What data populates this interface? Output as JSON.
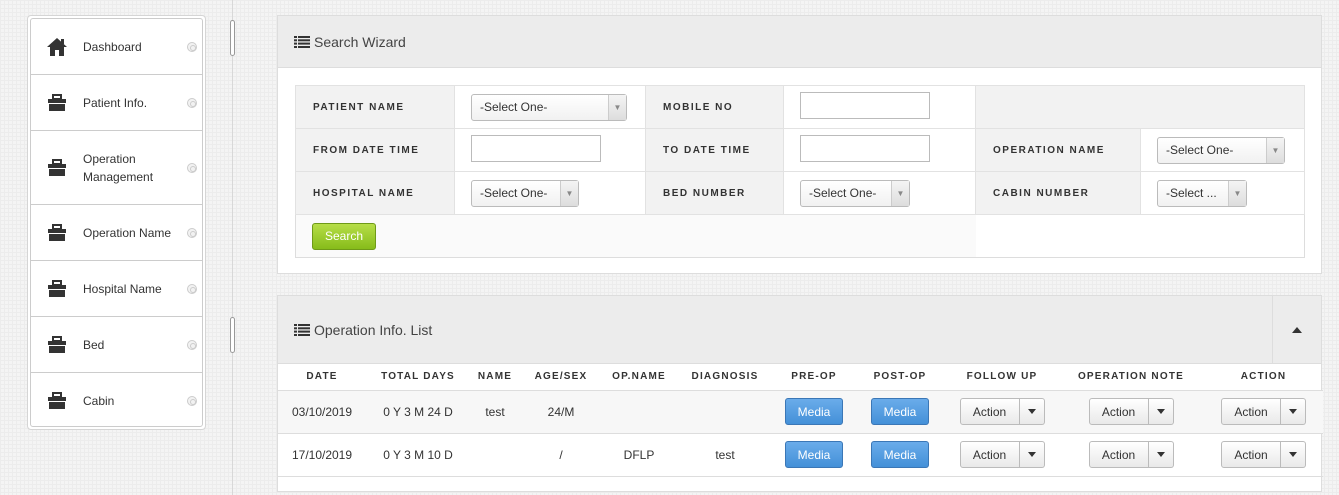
{
  "sidebar": {
    "items": [
      {
        "label": "Dashboard",
        "icon": "home-icon"
      },
      {
        "label": "Patient Info.",
        "icon": "briefcase-icon"
      },
      {
        "label": "Operation Management",
        "icon": "briefcase-icon"
      },
      {
        "label": "Operation Name",
        "icon": "briefcase-icon"
      },
      {
        "label": "Hospital Name",
        "icon": "briefcase-icon"
      },
      {
        "label": "Bed",
        "icon": "briefcase-icon"
      },
      {
        "label": "Cabin",
        "icon": "briefcase-icon"
      }
    ]
  },
  "search": {
    "title": "Search Wizard",
    "labels": {
      "patient_name": "PATIENT NAME",
      "mobile_no": "MOBILE NO",
      "from_date": "FROM DATE TIME",
      "to_date": "TO DATE TIME",
      "operation_name": "OPERATION NAME",
      "hospital_name": "HOSPITAL NAME",
      "bed_number": "BED NUMBER",
      "cabin_number": "CABIN NUMBER"
    },
    "values": {
      "patient_name": "-Select One-",
      "operation_name": "-Select One-",
      "hospital_name": "-Select One-",
      "bed_number": "-Select One-",
      "cabin_number": "-Select ..."
    },
    "button": "Search"
  },
  "ops": {
    "title": "Operation Info. List",
    "headers": [
      "DATE",
      "TOTAL DAYS",
      "NAME",
      "AGE/SEX",
      "OP.NAME",
      "DIAGNOSIS",
      "PRE-OP",
      "POST-OP",
      "FOLLOW UP",
      "OPERATION NOTE",
      "ACTION"
    ],
    "rows": [
      {
        "date": "03/10/2019",
        "days": "0 Y 3 M 24 D",
        "name": "test",
        "agesex": "24/M",
        "opname": "",
        "diagnosis": ""
      },
      {
        "date": "17/10/2019",
        "days": "0 Y 3 M 10 D",
        "name": "",
        "agesex": "/",
        "opname": "DFLP",
        "diagnosis": "test"
      }
    ],
    "media_label": "Media",
    "action_label": "Action"
  },
  "colors": {
    "accent_green": "#8dc21f",
    "media_blue": "#5aa0e2"
  }
}
